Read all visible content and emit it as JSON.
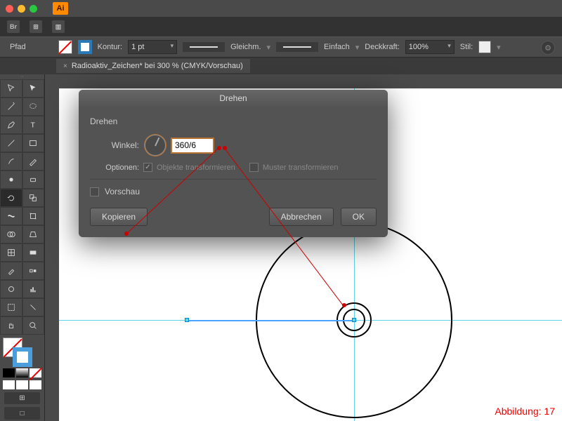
{
  "window": {
    "app": "Ai",
    "close_c": "#ff5f57",
    "min_c": "#febc2e",
    "max_c": "#28c840"
  },
  "menu": {
    "items": [
      "Br",
      "⊞",
      "▥"
    ]
  },
  "controlbar": {
    "path_label": "Pfad",
    "kontur_label": "Kontur:",
    "stroke_val": "1 pt",
    "cap_label": "Gleichm.",
    "profile_label": "Einfach",
    "opacity_label": "Deckkraft:",
    "opacity_val": "100%",
    "style_label": "Stil:"
  },
  "doc": {
    "tab": "Radioaktiv_Zeichen* bei 300 % (CMYK/Vorschau)",
    "close": "×"
  },
  "tools": [
    "select",
    "direct",
    "wand",
    "lasso",
    "pen",
    "type",
    "line",
    "rect",
    "brush",
    "pencil",
    "blob",
    "eraser",
    "rotate",
    "scale",
    "width",
    "freetr",
    "shaper",
    "perspective",
    "mesh",
    "gradient",
    "eyedrop",
    "blend",
    "symbol",
    "graph",
    "artboard",
    "slice",
    "hand",
    "zoom"
  ],
  "footer_btns": [
    "⊞",
    "□"
  ],
  "dialog": {
    "title": "Drehen",
    "section": "Drehen",
    "angle_label": "Winkel:",
    "angle_value": "360/6",
    "options_label": "Optionen:",
    "opt_objects": "Objekte transformieren",
    "opt_pattern": "Muster transformieren",
    "preview": "Vorschau",
    "copy": "Kopieren",
    "cancel": "Abbrechen",
    "ok": "OK"
  },
  "caption": "Abbildung: 17",
  "chart_data": {
    "type": "table",
    "note": "no chart data"
  }
}
